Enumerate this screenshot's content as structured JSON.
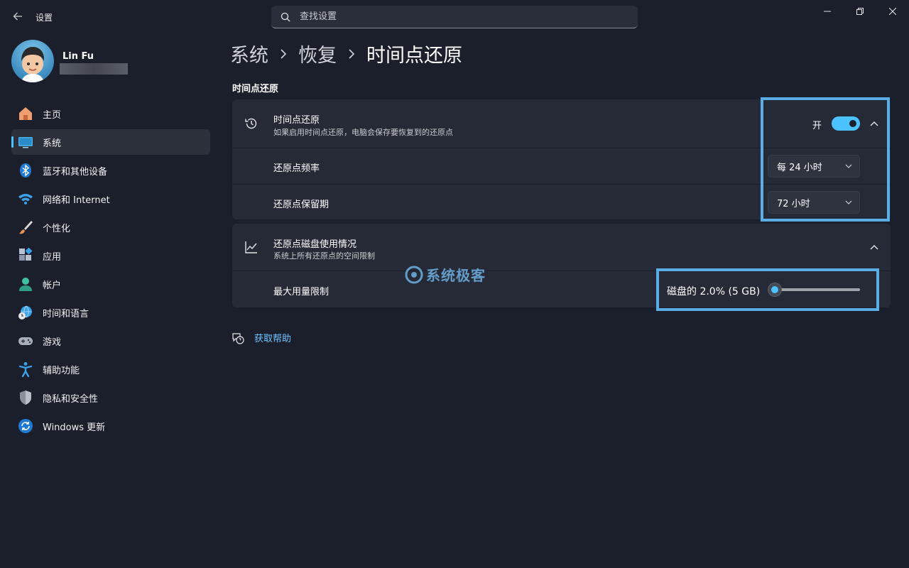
{
  "window": {
    "app_title": "设置",
    "search_placeholder": "查找设置"
  },
  "profile": {
    "name": "Lin Fu"
  },
  "sidebar": {
    "items": [
      {
        "label": "主页",
        "icon": "home-icon",
        "active": false
      },
      {
        "label": "系统",
        "icon": "system-icon",
        "active": true
      },
      {
        "label": "蓝牙和其他设备",
        "icon": "bluetooth-icon",
        "active": false
      },
      {
        "label": "网络和 Internet",
        "icon": "wifi-icon",
        "active": false
      },
      {
        "label": "个性化",
        "icon": "brush-icon",
        "active": false
      },
      {
        "label": "应用",
        "icon": "apps-icon",
        "active": false
      },
      {
        "label": "帐户",
        "icon": "account-icon",
        "active": false
      },
      {
        "label": "时间和语言",
        "icon": "globe-clock-icon",
        "active": false
      },
      {
        "label": "游戏",
        "icon": "gamepad-icon",
        "active": false
      },
      {
        "label": "辅助功能",
        "icon": "accessibility-icon",
        "active": false
      },
      {
        "label": "隐私和安全性",
        "icon": "shield-icon",
        "active": false
      },
      {
        "label": "Windows 更新",
        "icon": "update-icon",
        "active": false
      }
    ]
  },
  "breadcrumb": [
    "系统",
    "恢复",
    "时间点还原"
  ],
  "section_title": "时间点还原",
  "restore_card": {
    "title": "时间点还原",
    "subtitle": "如果启用时间点还原，电脑会保存要恢复到的还原点",
    "toggle_label": "开",
    "toggle_on": true,
    "frequency_label": "还原点频率",
    "frequency_value": "每 24 小时",
    "retention_label": "还原点保留期",
    "retention_value": "72 小时"
  },
  "disk_card": {
    "title": "还原点磁盘使用情况",
    "subtitle": "系统上所有还原点的空间限制",
    "max_label": "最大用量限制",
    "slider_value_text": "磁盘的 2.0% (5 GB)",
    "slider_fraction": 0.02
  },
  "watermark": "系统极客",
  "help_link": "获取帮助",
  "colors": {
    "accent": "#4cc2ff",
    "highlight": "#5aaee5",
    "background": "#1b1f2b",
    "card": "#262a36"
  }
}
